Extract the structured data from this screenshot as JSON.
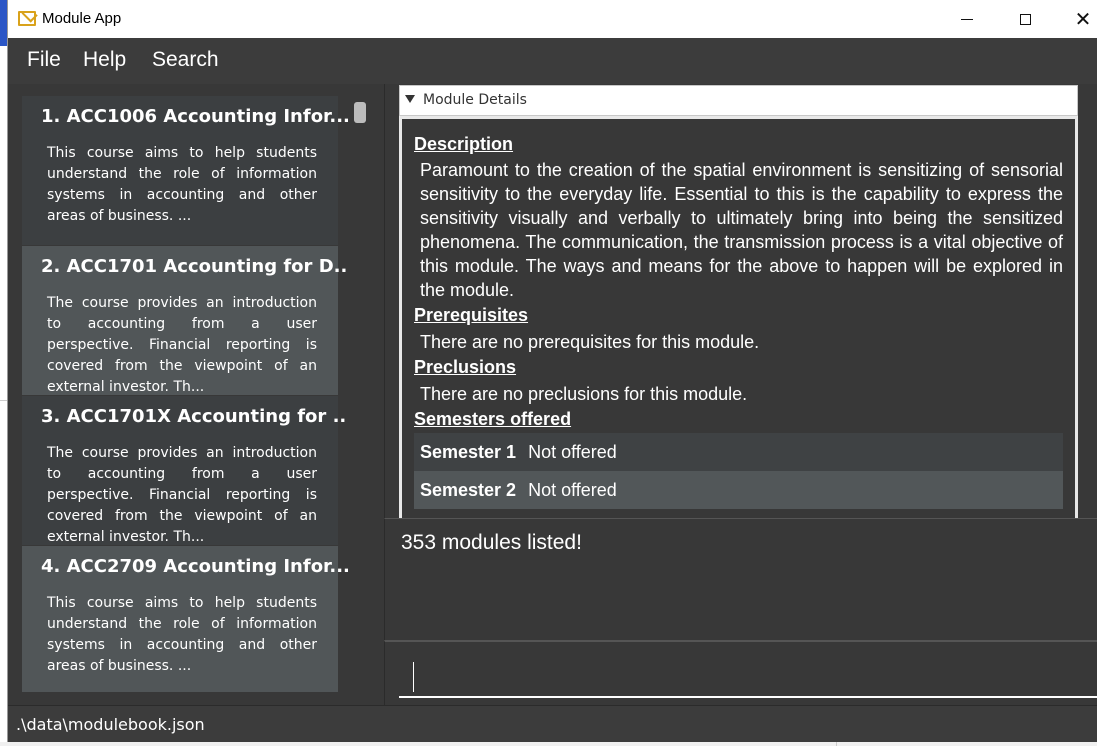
{
  "window": {
    "title": "Module App",
    "minimize_symbol": "",
    "maximize_symbol": "",
    "close_symbol": "✕"
  },
  "menu": [
    "File",
    "Help",
    "Search"
  ],
  "modules": [
    {
      "title": "1.  ACC1006 Accounting Infor...",
      "description": "This course aims to help students understand the role of information systems in accounting and other areas of business. ..."
    },
    {
      "title": "2.  ACC1701 Accounting for D...",
      "description": "The course provides an introduction to accounting from a user perspective. Financial reporting is covered from the viewpoint of an external investor. Th..."
    },
    {
      "title": "3.  ACC1701X Accounting for ...",
      "description": "The course provides an introduction to accounting from a user perspective. Financial reporting is covered from the viewpoint of an external investor. Th..."
    },
    {
      "title": "4.  ACC2709 Accounting Infor...",
      "description": "This course aims to help students understand the role of information systems in accounting and other areas of business. ..."
    }
  ],
  "details": {
    "header": "Module Details",
    "description_heading": "Description",
    "description": "Paramount to the creation of the spatial environment is sensitizing of sensorial sensitivity to the everyday life. Essential to this is the capability to express the sensitivity visually and verbally to ultimately bring into being the sensitized phenomena. The communication, the transmission process is a vital objective of this module. The ways and means for the above to happen will be explored in the module.",
    "prerequisites_heading": "Prerequisites",
    "prerequisites": "There are no prerequisites for this module.",
    "preclusions_heading": "Preclusions",
    "preclusions": "There are no preclusions for this module.",
    "semesters_heading": "Semesters offered",
    "semesters": [
      {
        "name": "Semester 1",
        "status": "Not offered"
      },
      {
        "name": "Semester 2",
        "status": "Not offered"
      }
    ]
  },
  "result": "353 modules listed!",
  "command": {
    "value": "",
    "placeholder": ""
  },
  "status": ".\\data\\modulebook.json",
  "colors": {
    "menubar": "#3c3c3c",
    "panel": "#383838",
    "card_odd": "#3c3f41",
    "card_even": "#515658",
    "app_icon": "#d9a21b"
  }
}
